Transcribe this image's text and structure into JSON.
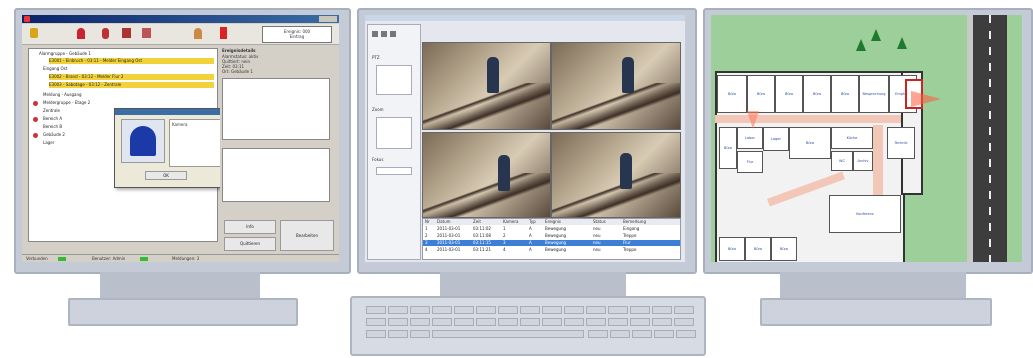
{
  "monitor_left": {
    "window_title": "",
    "status_box": [
      "Ereignis: 000",
      "Eintrag"
    ],
    "tree_items": [
      "Alarmgruppe - Gebäude 1",
      "Eingang Ost",
      "Meldung - Ausgang",
      "Meldergruppe - Etage 2",
      "Zentrale",
      "Bereich A",
      "Bereich B",
      "Gebäude 2",
      "Lager"
    ],
    "highlight_rows": [
      "E3001 - Einbruch - 03:11 - Melder Eingang Ost",
      "E3002 - Brand - 03:12 - Melder Flur 2",
      "E3003 - Sabotage - 03:12 - Zentrale"
    ],
    "detail_title": "Ereignisdetails",
    "detail_lines": [
      "Alarmstatus: aktiv",
      "Quittiert: nein",
      "Zeit: 03:11",
      "Ort: Gebäude 1"
    ],
    "popup_label": "Kamera",
    "ok_label": "OK",
    "action_label_1": "Info",
    "action_label_2": "Quittieren",
    "action_label_3": "Bearbeiten",
    "statusbar": [
      "Verbunden",
      "Benutzer: Admin",
      "Meldungen: 3"
    ]
  },
  "monitor_center": {
    "side_controls": [
      "PTZ",
      "Zoom",
      "Fokus"
    ],
    "grid_headers": [
      "Nr",
      "Datum",
      "Zeit",
      "Kamera",
      "Typ",
      "Ereignis",
      "Status",
      "Bemerkung"
    ],
    "grid_rows": [
      [
        "1",
        "2011-03-01",
        "03:11:02",
        "1",
        "A",
        "Bewegung",
        "neu",
        "Eingang"
      ],
      [
        "2",
        "2011-03-01",
        "03:11:08",
        "2",
        "A",
        "Bewegung",
        "neu",
        "Treppe"
      ],
      [
        "3",
        "2011-03-01",
        "03:11:15",
        "3",
        "A",
        "Bewegung",
        "neu",
        "Flur"
      ],
      [
        "4",
        "2011-03-01",
        "03:11:21",
        "4",
        "A",
        "Bewegung",
        "neu",
        "Treppe"
      ]
    ]
  },
  "monitor_right": {
    "room_labels": [
      "Büro",
      "Büro",
      "Büro",
      "Büro",
      "Büro",
      "Besprechung",
      "Empfang",
      "Büro",
      "Labor",
      "Lager",
      "Büro",
      "Küche",
      "Technik",
      "Flur",
      "WC",
      "Archiv",
      "Konferenz",
      "Büro",
      "Büro",
      "Büro"
    ]
  },
  "colors": {
    "highlight": "#f2d23a",
    "lawn": "#9dcf9a",
    "road": "#3d3d3d",
    "bezel": "#c4cad6"
  }
}
